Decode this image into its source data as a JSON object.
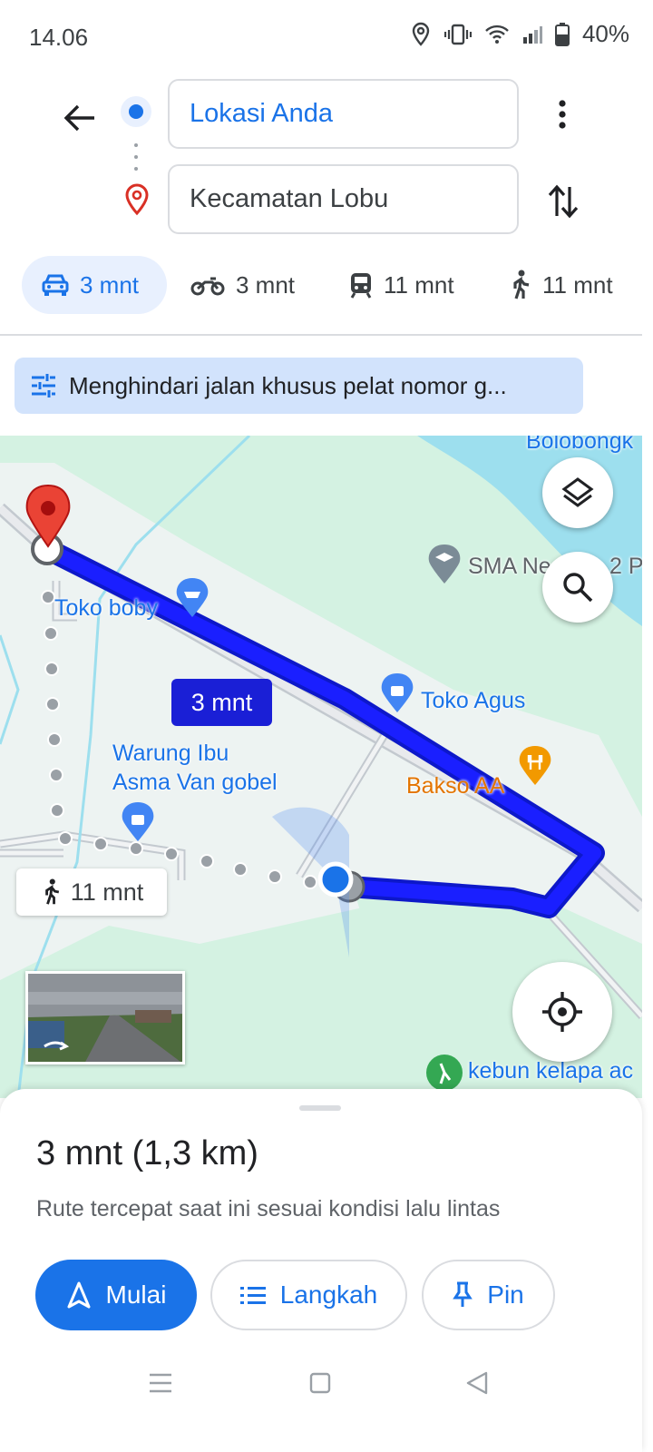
{
  "status_bar": {
    "time": "14.06",
    "battery": "40%"
  },
  "search": {
    "origin": "Lokasi Anda",
    "destination": "Kecamatan Lobu"
  },
  "modes": [
    {
      "name": "car",
      "time": "3 mnt",
      "active": true
    },
    {
      "name": "motorcycle",
      "time": "3 mnt",
      "active": false
    },
    {
      "name": "transit",
      "time": "11 mnt",
      "active": false
    },
    {
      "name": "walk",
      "time": "11 mnt",
      "active": false
    }
  ],
  "route_option_chip": "Menghindari jalan khusus pelat nomor g...",
  "map": {
    "labels": {
      "bolobongk": "Bolobongk",
      "sma": "SMA Ne",
      "sma_tail": "2 P",
      "toko_boby": "Toko boby",
      "toko_agus": "Toko Agus",
      "warung_line1": "Warung Ibu",
      "warung_line2": "Asma Van gobel",
      "bakso": "Bakso AA",
      "kebun": "kebun kelapa ac"
    },
    "route_time_bubble": "3 mnt",
    "walk_badge": "11 mnt",
    "colors": {
      "route": "#1a1fff",
      "route_bubble": "#1a1fd6",
      "land": "#d4f2e2",
      "water": "#9ddfee"
    }
  },
  "sheet": {
    "summary": "3 mnt (1,3 km)",
    "subtitle": "Rute tercepat saat ini sesuai kondisi lalu lintas",
    "start_button": "Mulai",
    "steps_button": "Langkah",
    "pin_button": "Pin"
  }
}
